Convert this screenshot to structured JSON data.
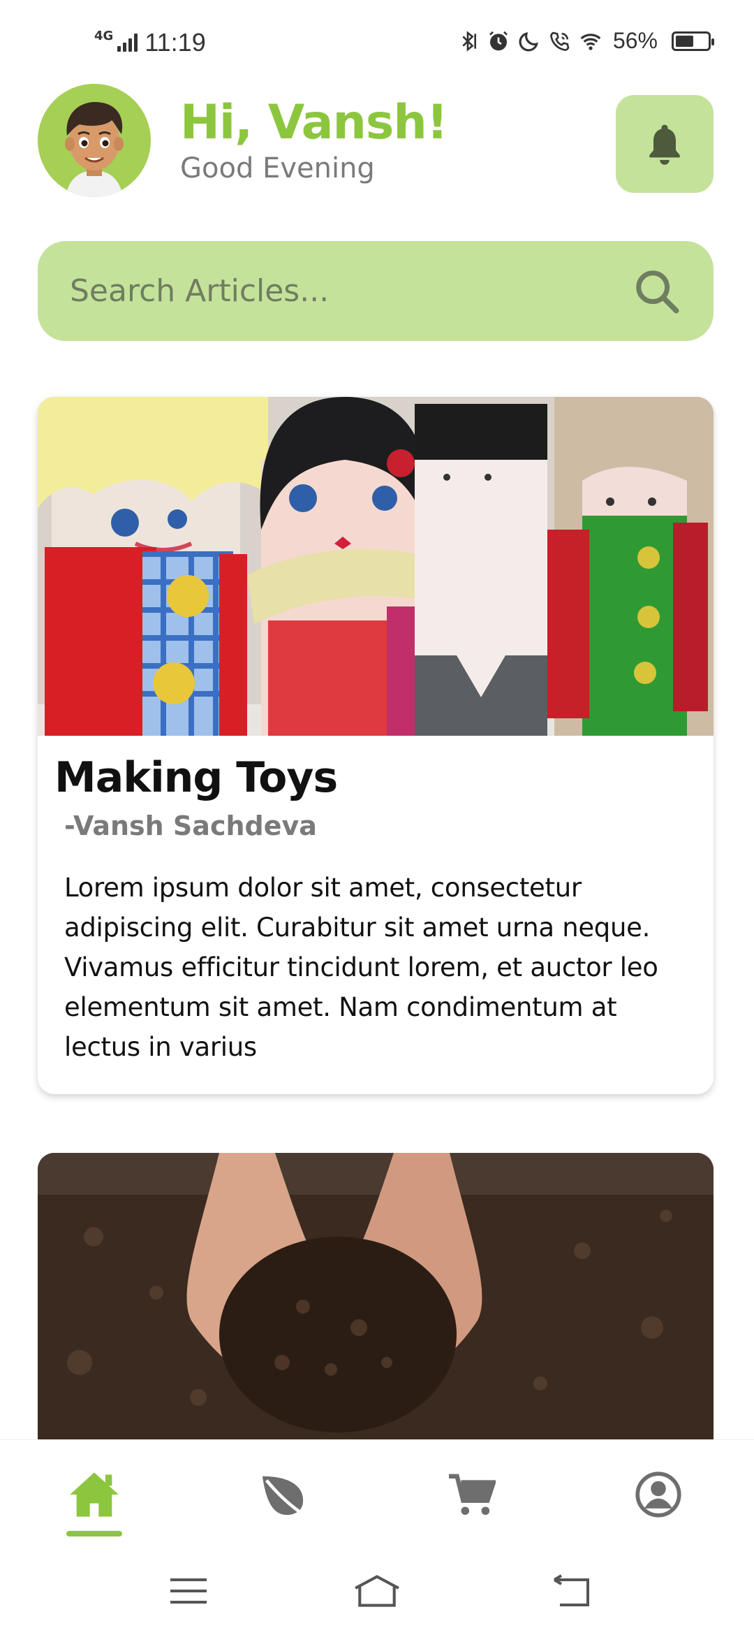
{
  "status_bar": {
    "network": "4G",
    "time": "11:19",
    "battery_percent": "56%",
    "battery_level": 0.56,
    "icons": [
      "bluetooth-icon",
      "alarm-icon",
      "moon-icon",
      "wifi-calling-icon",
      "wifi-icon",
      "battery-icon"
    ]
  },
  "header": {
    "greeting": "Hi, Vansh!",
    "subtitle": "Good Evening",
    "avatar_icon": "avatar-cartoon-boy",
    "bell_icon": "bell-icon"
  },
  "search": {
    "placeholder": "Search Articles...",
    "icon": "search-icon"
  },
  "articles": [
    {
      "title": "Making Toys",
      "author": "-Vansh Sachdeva",
      "body": "Lorem ipsum dolor sit amet, consectetur adipiscing elit. Curabitur sit amet urna neque. Vivamus efficitur tincidunt lorem, et auctor leo elementum sit amet. Nam condimentum at lectus in varius",
      "image": "handmade-toilet-roll-dolls"
    },
    {
      "image": "hands-holding-soil"
    }
  ],
  "bottom_nav": {
    "items": [
      "home-icon",
      "leaf-icon",
      "cart-icon",
      "profile-icon"
    ],
    "active_index": 0
  },
  "system_nav": [
    "menu-icon",
    "home-icon",
    "back-icon"
  ],
  "colors": {
    "accent": "#8cc63f",
    "accent_light": "#c5e29b",
    "text_muted": "#7a7a7a",
    "icon_gray": "#6e6e6e"
  }
}
